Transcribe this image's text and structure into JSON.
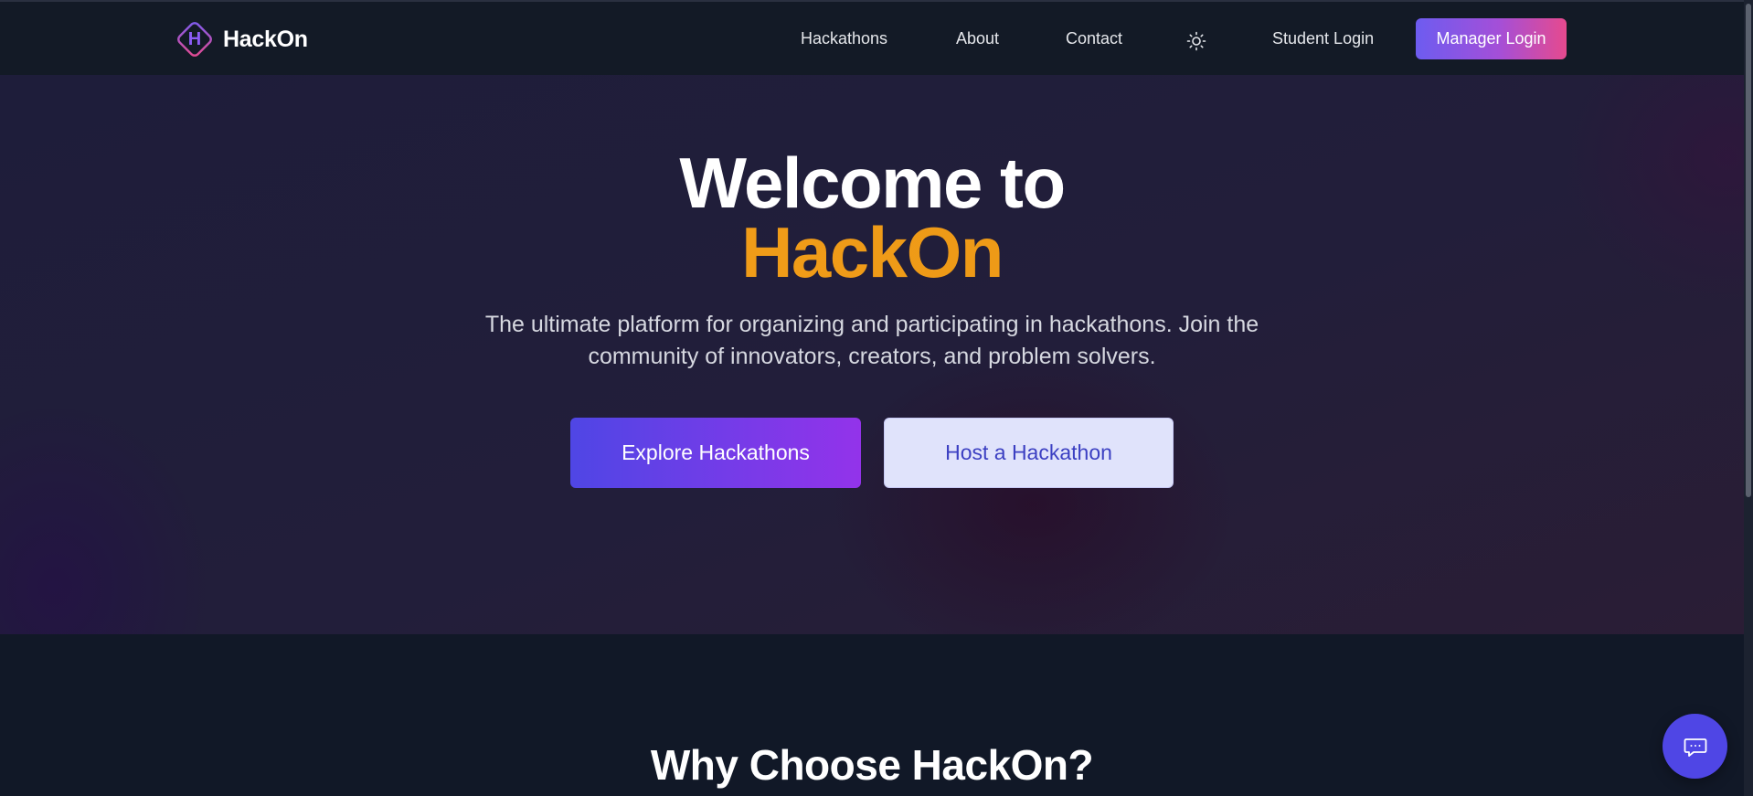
{
  "brand": {
    "logo_letter": "H",
    "name": "HackOn",
    "logo_icon": "diamond-logo-icon"
  },
  "nav": {
    "links": [
      {
        "label": "Hackathons"
      },
      {
        "label": "About"
      },
      {
        "label": "Contact"
      }
    ],
    "theme_toggle_icon": "sun-icon",
    "student_login": "Student Login",
    "manager_login": "Manager Login"
  },
  "hero": {
    "title_line1": "Welcome to",
    "title_line2": "HackOn",
    "subtitle": "The ultimate platform for organizing and participating in hackathons. Join the community of innovators, creators, and problem solvers.",
    "primary_cta": "Explore Hackathons",
    "secondary_cta": "Host a Hackathon"
  },
  "section": {
    "why_title": "Why Choose HackOn?"
  },
  "chat": {
    "icon": "chat-bubble-icon"
  },
  "colors": {
    "accent_gradient_start": "#4f46e5",
    "accent_gradient_end": "#9333ea",
    "title_highlight": "#f6a21c",
    "manager_gradient_end": "#e64a8e",
    "background": "#111827"
  }
}
